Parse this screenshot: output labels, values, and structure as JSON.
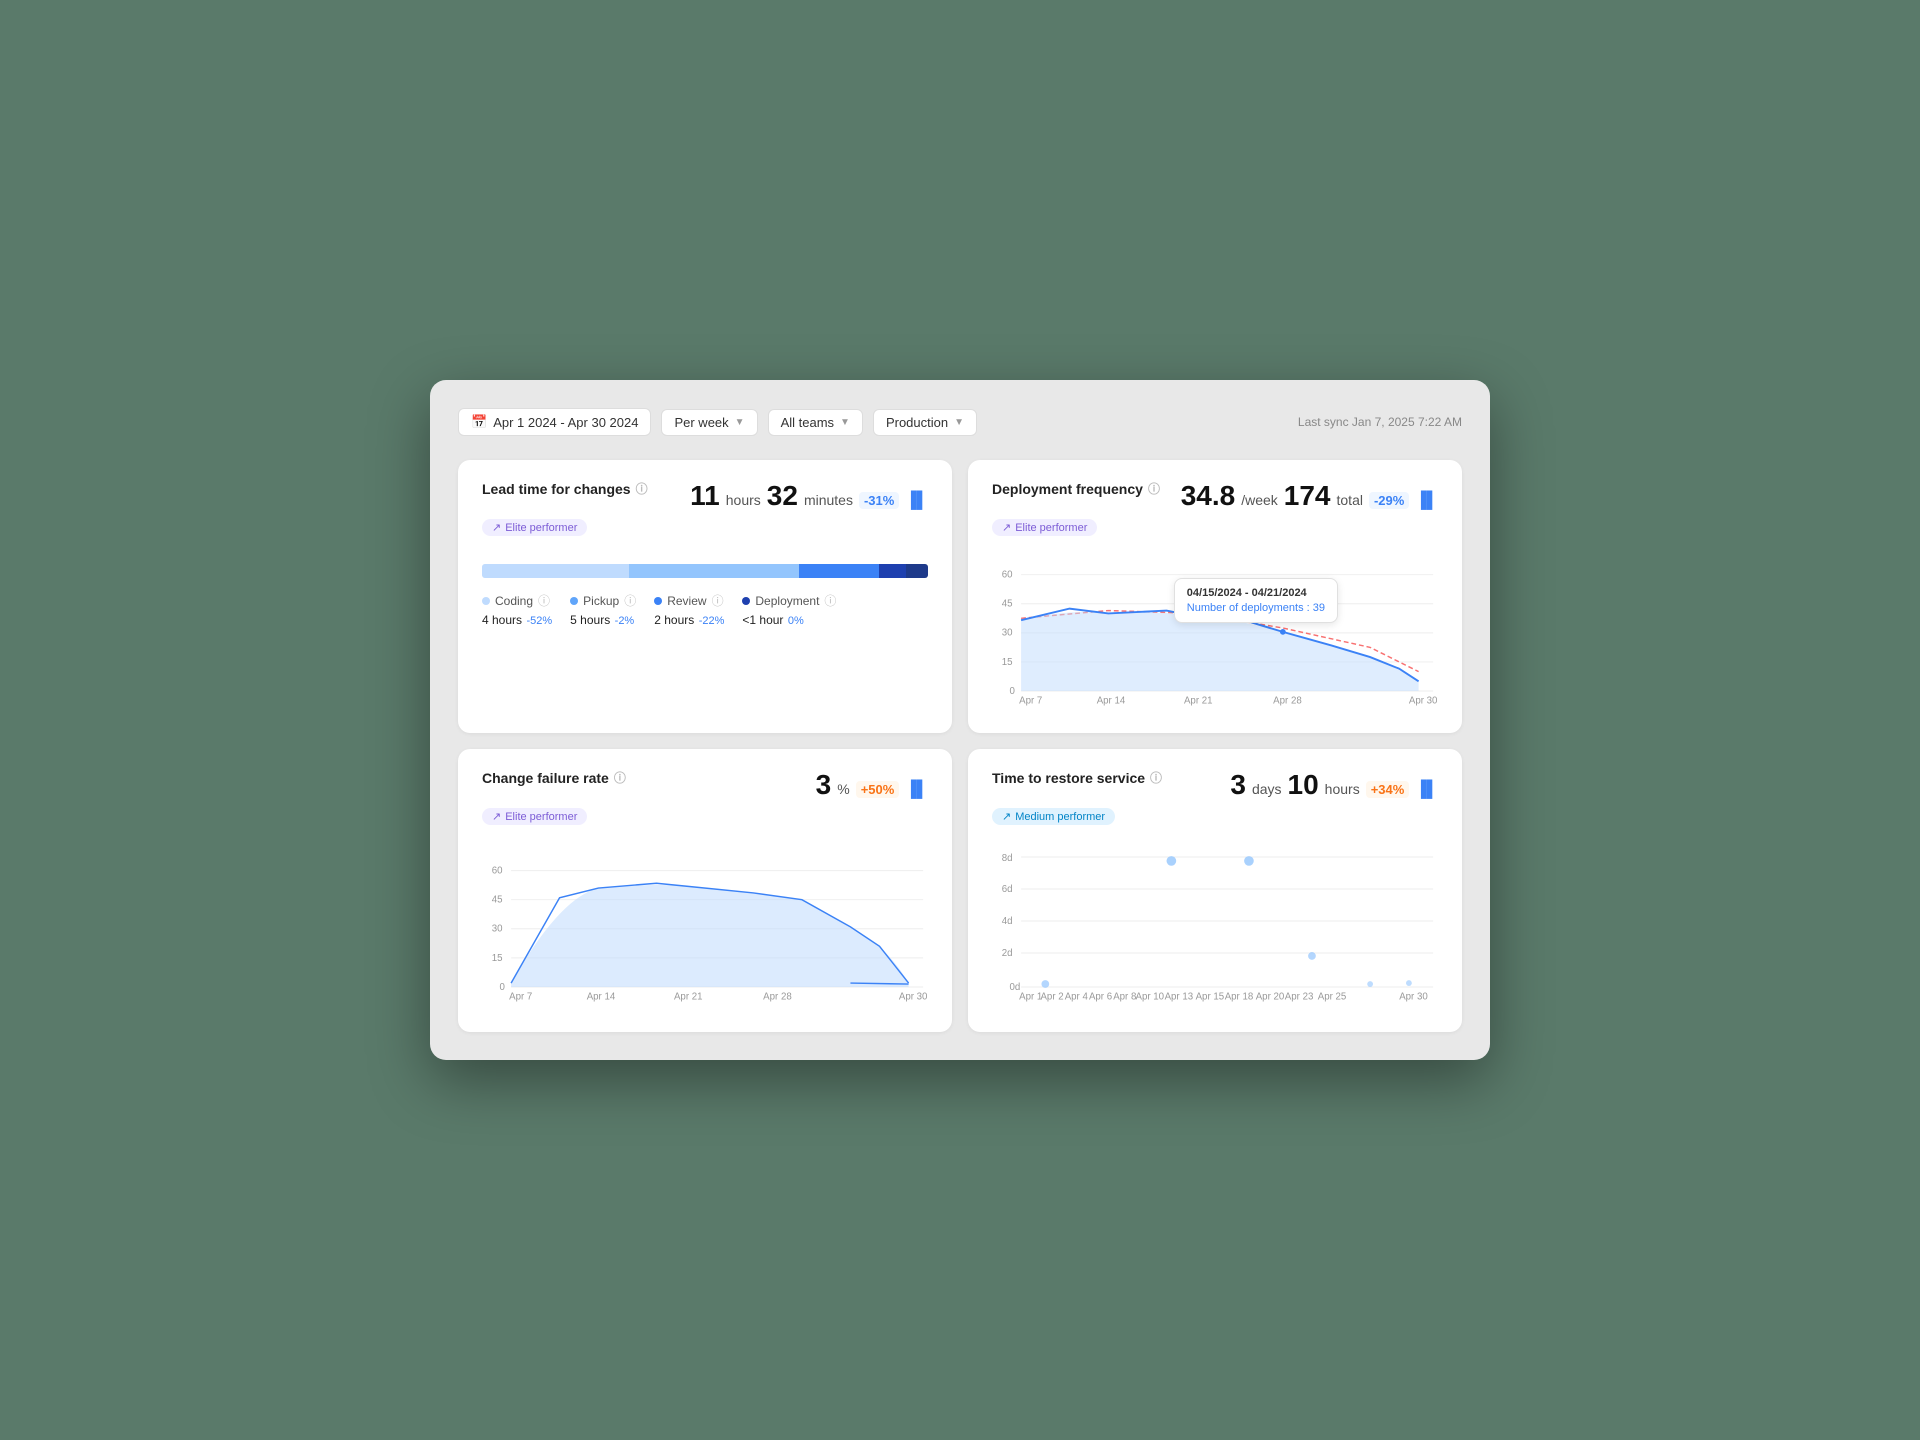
{
  "toolbar": {
    "date_range": "Apr 1 2024 - Apr 30 2024",
    "per_week_label": "Per week",
    "all_teams_label": "All teams",
    "production_label": "Production",
    "last_sync": "Last sync Jan 7, 2025 7:22 AM"
  },
  "lead_time": {
    "title": "Lead time for changes",
    "hours": "11",
    "hours_unit": "hours",
    "minutes": "32",
    "minutes_unit": "minutes",
    "change": "-31%",
    "performer": "Elite performer",
    "coding_label": "Coding",
    "coding_val": "4 hours",
    "coding_change": "-52%",
    "pickup_label": "Pickup",
    "pickup_val": "5 hours",
    "pickup_change": "-2%",
    "review_label": "Review",
    "review_val": "2 hours",
    "review_change": "-22%",
    "deployment_label": "Deployment",
    "deployment_val": "<1 hour",
    "deployment_change": "0%"
  },
  "deployment_freq": {
    "title": "Deployment frequency",
    "per_week": "34.8",
    "per_week_unit": "/week",
    "total": "174",
    "total_unit": "total",
    "change": "-29%",
    "performer": "Elite performer",
    "tooltip_date": "04/15/2024 - 04/21/2024",
    "tooltip_label": "Number of deployments :",
    "tooltip_value": "39",
    "x_labels": [
      "Apr 7",
      "Apr 14",
      "Apr 21",
      "Apr 28",
      "Apr 30"
    ],
    "y_labels": [
      "0",
      "15",
      "30",
      "45",
      "60"
    ]
  },
  "change_failure": {
    "title": "Change failure rate",
    "value": "3",
    "unit": "%",
    "change": "+50%",
    "performer": "Elite performer",
    "x_labels": [
      "Apr 7",
      "Apr 14",
      "Apr 21",
      "Apr 28",
      "Apr 30"
    ],
    "y_labels": [
      "0",
      "15",
      "30",
      "45",
      "60"
    ]
  },
  "restore_time": {
    "title": "Time to restore service",
    "days": "3",
    "days_unit": "days",
    "hours": "10",
    "hours_unit": "hours",
    "change": "+34%",
    "performer": "Medium performer",
    "x_labels": [
      "Apr 1",
      "Apr 2",
      "Apr 4",
      "Apr 6",
      "Apr 8",
      "Apr 10",
      "Apr 13",
      "Apr 15",
      "Apr 18",
      "Apr 20",
      "Apr 23",
      "Apr 25",
      "Apr 30"
    ],
    "y_labels": [
      "0d",
      "2d",
      "4d",
      "6d",
      "8d"
    ]
  }
}
